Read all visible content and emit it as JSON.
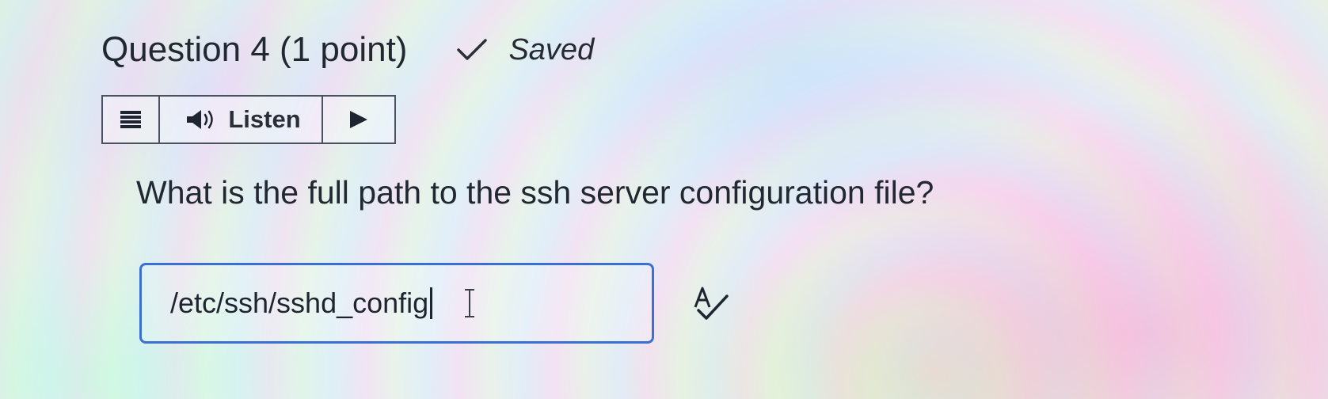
{
  "question": {
    "title": "Question 4 (1 point)",
    "status_text": "Saved",
    "status_icon": "checkmark-icon",
    "prompt": "What is the full path to the ssh server configuration file?"
  },
  "toolbar": {
    "menu_icon": "hamburger-menu-icon",
    "listen_icon": "speaker-icon",
    "listen_label": "Listen",
    "play_icon": "play-icon"
  },
  "answer": {
    "value": "/etc/ssh/sshd_config",
    "spellcheck_icon": "spellcheck-icon"
  },
  "colors": {
    "text": "#222831",
    "field_border": "#3b6fd4",
    "toolbar_border": "#4a5260"
  }
}
